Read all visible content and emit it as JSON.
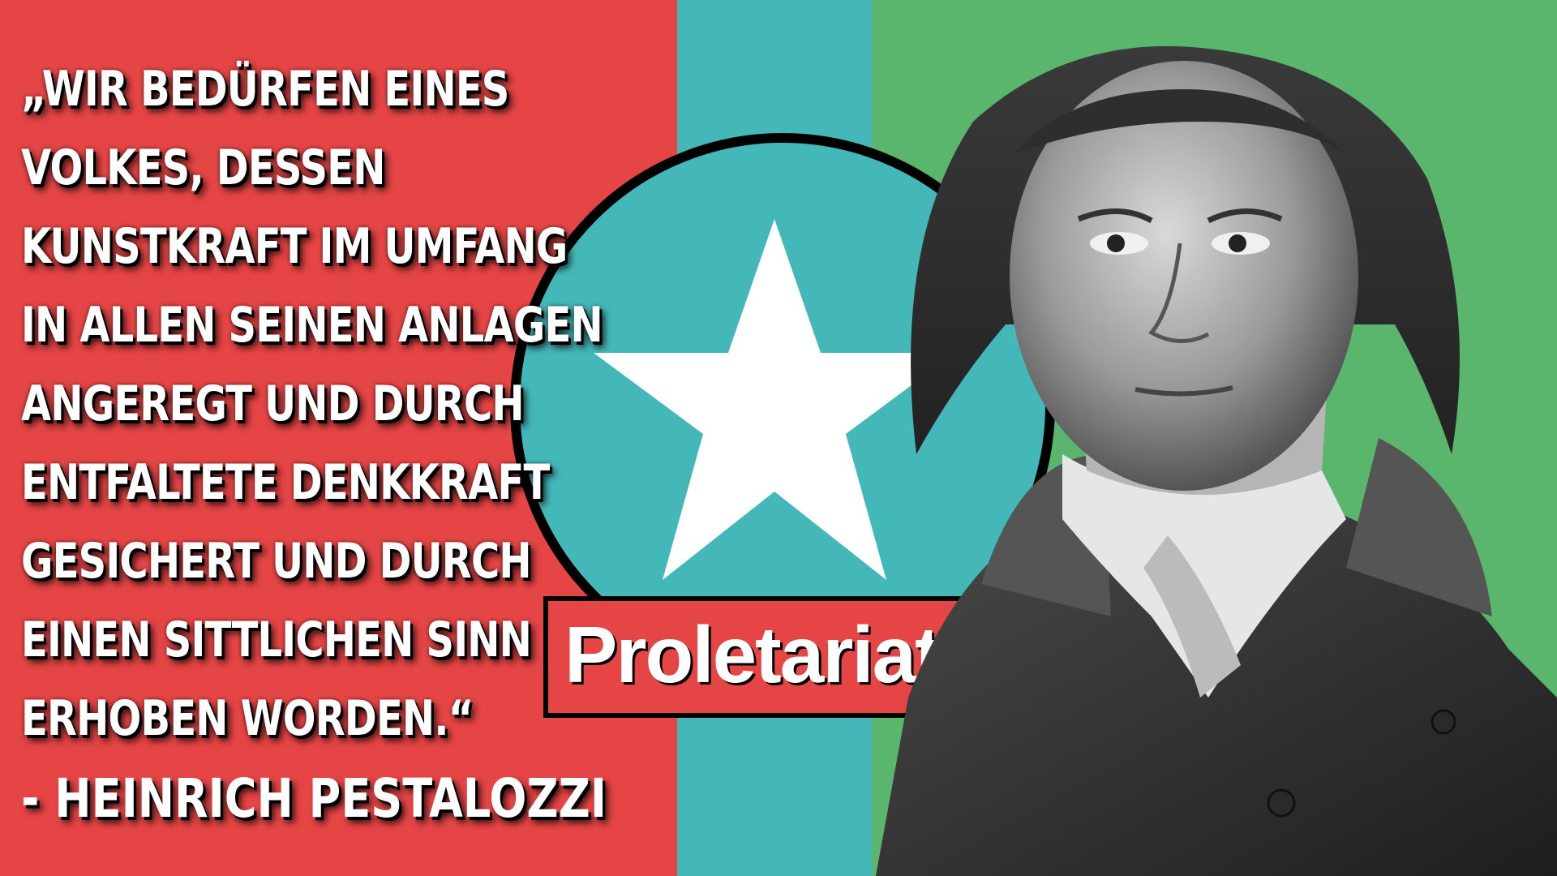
{
  "colors": {
    "red": "#e64545",
    "teal": "#44b8b9",
    "green": "#5ab56d",
    "white": "#ffffff",
    "black": "#000000"
  },
  "quote": {
    "lines": [
      "„WIR BEDÜRFEN EINES",
      "VOLKES, DESSEN",
      "KUNSTKRAFT IM UMFANG",
      "IN ALLEN SEINEN ANLAGEN",
      "ANGEREGT UND DURCH",
      "ENTFALTETE DENKKRAFT",
      "GESICHERT UND DURCH",
      "EINEN SITTLICHEN SINN",
      "ERHOBEN WORDEN.“"
    ],
    "author": "- HEINRICH PESTALOZZI"
  },
  "logo": {
    "icon": "star-icon",
    "brand": "Proletariat.ch"
  },
  "portrait": {
    "icon": "portrait-engraving"
  }
}
